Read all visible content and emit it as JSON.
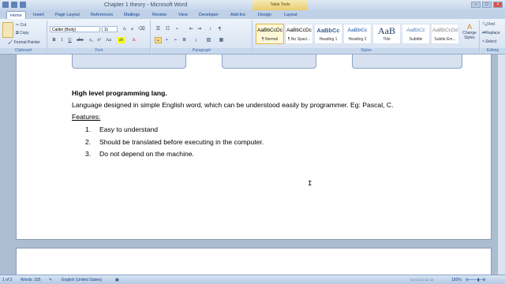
{
  "window": {
    "title": "Chapter 1 theory - Microsoft Word",
    "table_tools": "Table Tools"
  },
  "tabs": [
    "Home",
    "Insert",
    "Page Layout",
    "References",
    "Mailings",
    "Review",
    "View",
    "Developer",
    "Add-Ins",
    "Design",
    "Layout"
  ],
  "clipboard": {
    "cut": "Cut",
    "copy": "Copy",
    "format_painter": "Format Painter",
    "label": "Clipboard"
  },
  "font": {
    "name": "Calibri (Body)",
    "size": "11",
    "label": "Font"
  },
  "paragraph": {
    "label": "Paragraph"
  },
  "styles": {
    "label": "Styles",
    "items": [
      {
        "preview": "AaBbCcDc",
        "name": "¶ Normal"
      },
      {
        "preview": "AaBbCcDc",
        "name": "¶ No Spaci..."
      },
      {
        "preview": "AaBbCc",
        "name": "Heading 1"
      },
      {
        "preview": "AaBbCc",
        "name": "Heading 2"
      },
      {
        "preview": "AaB",
        "name": "Title"
      },
      {
        "preview": "AaBbCc",
        "name": "Subtitle"
      },
      {
        "preview": "AaBbCcDd",
        "name": "Subtle Em..."
      }
    ],
    "change_styles": "Change Styles"
  },
  "editing": {
    "find": "Find",
    "replace": "Replace",
    "select": "Select",
    "label": "Editing"
  },
  "document": {
    "heading": "High level programming lang.",
    "definition": "Language designed in simple English word, which can be understood easily by programmer. Eg: Pascal, C.",
    "features_label": "Features:",
    "features": [
      {
        "num": "1.",
        "text": "Easy to understand"
      },
      {
        "num": "2.",
        "text": "Should be translated before executing in the computer."
      },
      {
        "num": "3.",
        "text": "Do not depend on the machine."
      }
    ]
  },
  "status": {
    "page": "1 of 2",
    "words": "Words: 335",
    "language": "English (United States)",
    "zoom": "150%"
  }
}
